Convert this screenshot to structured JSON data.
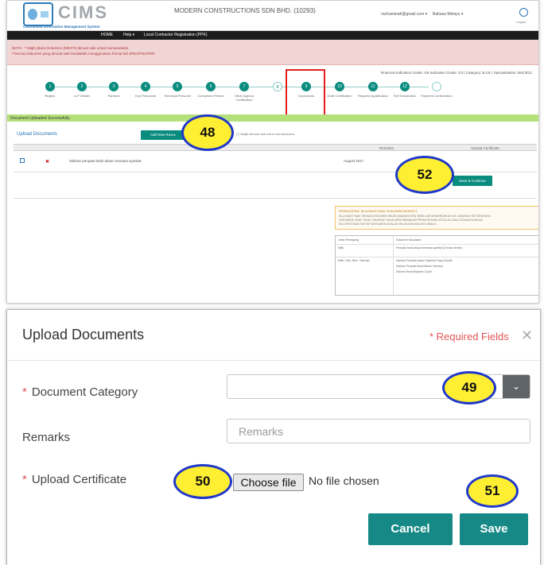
{
  "top": {
    "logo_text": "CIMS",
    "logo_subtitle": "Centralised Information Management System",
    "company_name": "MODERN CONSTRUCTIONS SDN BHD. (10293)",
    "user_email": "nurhaminah@gmail.com ▾",
    "language": "Bahasa Melayu ▾",
    "logout_label": "Logout",
    "nav": [
      "HOME",
      "Help ▾",
      "Local Contractor Registration (PPK)"
    ],
    "notice_line1": "NOTA : * Wajib (Baris Dokumen (MESTI) dimuat naik untuk memandukan.",
    "notice_line2": "**Semua dokumen yang dimuat naik hendaklah menggunakan format fail JPEG/PNG/PDF.",
    "financial_info": "Financial Indication Grade: G6   Indication Grade: G3 | Category: B,CE | Specialisation: BHL/E21",
    "steps": [
      {
        "num": "1",
        "label": "Registr."
      },
      {
        "num": "2",
        "label": "LLP Details"
      },
      {
        "num": "3",
        "label": "Partners"
      },
      {
        "num": "4",
        "label": "Key Personnel"
      },
      {
        "num": "5",
        "label": "Technical Personel"
      },
      {
        "num": "6",
        "label": "Competent Person"
      },
      {
        "num": "7",
        "label": "Other Agency Certification"
      },
      {
        "num": "8",
        "label": ""
      },
      {
        "num": "9",
        "label": "Documents"
      },
      {
        "num": "10",
        "label": "Draft Certification"
      },
      {
        "num": "11",
        "label": "Request Qualification"
      },
      {
        "num": "12",
        "label": "Self Declaration"
      },
      {
        "num": "",
        "label": "Payment Confirmation"
      }
    ],
    "success_msg": "Document Uploaded Successfully",
    "upload_title": "Upload Documents",
    "add_new_label": "Add New Row ▸",
    "tiny_note": "(*) Wajib dimuat naik untuk memandukan.",
    "table_headers": {
      "remarks": "Remarks",
      "certificate": "Upload Certificate"
    },
    "row": {
      "document": "Salinan penyata bank akaun semasa syarikat",
      "remarks": "August 2017",
      "delete": "✖"
    },
    "save_continue": "Save & Continue",
    "peringatan_title": "PERINGATAN: SILA MUAT NAIK DOKUMEN BERIKUT",
    "peringatan_body1": "SILA MUAT NAIK SEMUA DOKUMEN WAJIB (MANDATORI) SEBELUM MENERUSKAN KE LANGKAH SETERUSNYA.",
    "peringatan_body2": "DOKUMEN YANG TIDAK LENGKAP AKAN MENYEBABKAN PERMOHONAN DITOLAK ATAU DITANGGUHKAN.",
    "peringatan_body3": "SILA PASTIKAN SETIAP DOKUMEN ADALAH JELAS DAN BOLEH DIBACA.",
    "small_table": {
      "h1": "Jenis Pemegang",
      "h2": "Dokumen Mandatori",
      "r1c1": "Milik",
      "r1c2": "Penyata bank akaun semasa syarikat (3 bulan terkini)",
      "r2c1": "Milik / Sdn. Bhd. / Berhad",
      "r2c2": "Salinan Penyata Akaun Syarikat Yang Diaudit",
      "r2c3": "Salinan Penyata Bank Akaun Semasa",
      "r2c4": "Salinan Resit Bayaran Cukai"
    }
  },
  "modal": {
    "title": "Upload Documents",
    "required_fields": "* Required Fields",
    "close_glyph": "✕",
    "document_category_label": "Document Category",
    "remarks_label": "Remarks",
    "remarks_placeholder": "Remarks",
    "upload_certificate_label": "Upload Certificate",
    "choose_file_label": "Choose file",
    "no_file_text": "No file chosen",
    "cancel_label": "Cancel",
    "save_label": "Save",
    "dropdown_arrow": "⌄"
  },
  "callouts": {
    "c48": "48",
    "c49": "49",
    "c50": "50",
    "c51": "51",
    "c52": "52"
  },
  "colors": {
    "teal": "#168986",
    "callout_fill": "#ffef33",
    "callout_border": "#2038c8",
    "highlight_red": "#e41e1e",
    "required_red": "#e05555"
  }
}
